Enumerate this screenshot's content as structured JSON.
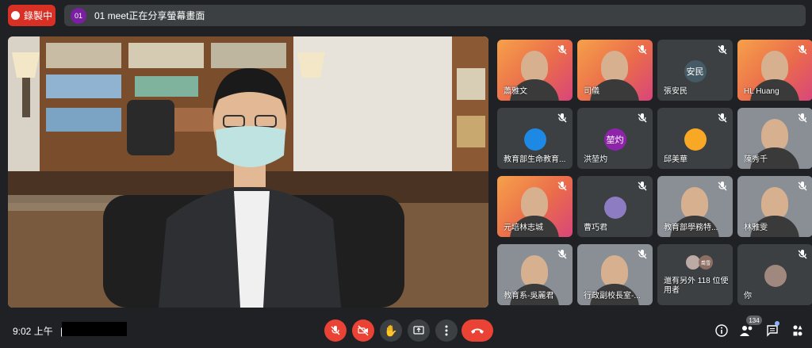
{
  "top": {
    "record_label": "錄製中",
    "presenter_avatar": "01",
    "presenting_text": "01 meet正在分享螢幕畫面"
  },
  "participants": [
    {
      "name": "蕭雅文",
      "style": "orange",
      "muted": true
    },
    {
      "name": "司儀",
      "style": "orange",
      "muted": true
    },
    {
      "name": "張安民",
      "style": "avatar",
      "initials": "安民",
      "avatar_color": "#455a64",
      "muted": true
    },
    {
      "name": "HL Huang",
      "style": "orange",
      "muted": true
    },
    {
      "name": "教育部生命教育...",
      "style": "avatar",
      "initials": "",
      "avatar_color": "#1e88e5",
      "muted": true
    },
    {
      "name": "洪堃灼",
      "style": "avatar",
      "initials": "堃灼",
      "avatar_color": "#8e24aa",
      "muted": true
    },
    {
      "name": "邱美華",
      "style": "avatar",
      "initials": "",
      "avatar_color": "#f9a825",
      "muted": true
    },
    {
      "name": "陳秀千",
      "style": "photo",
      "muted": true
    },
    {
      "name": "元培林志城",
      "style": "orange",
      "muted": true
    },
    {
      "name": "曹巧君",
      "style": "avatar",
      "initials": "",
      "avatar_color": "#8e7cc3",
      "muted": true
    },
    {
      "name": "教育部學務特...",
      "style": "photo",
      "muted": true
    },
    {
      "name": "林雅雯",
      "style": "photo",
      "muted": true
    },
    {
      "name": "教育系-吳麗君",
      "style": "photo",
      "muted": true
    },
    {
      "name": "行政副校長室-...",
      "style": "photo",
      "muted": true
    },
    {
      "name": "還有另外 118 位使用者",
      "style": "more",
      "muted": false
    },
    {
      "name": "你",
      "style": "avatar",
      "initials": "",
      "avatar_color": "#a1887f",
      "muted": true
    }
  ],
  "more_tile": {
    "avatar_text": "喬雪"
  },
  "bottom": {
    "time": "9:02 上午",
    "separator": "|",
    "participant_count": "134"
  },
  "icons": [
    "record-dot-icon",
    "mic-off-icon",
    "camera-off-icon",
    "raise-hand-icon",
    "present-icon",
    "more-options-icon",
    "end-call-icon",
    "info-icon",
    "people-icon",
    "chat-icon",
    "activities-icon"
  ]
}
